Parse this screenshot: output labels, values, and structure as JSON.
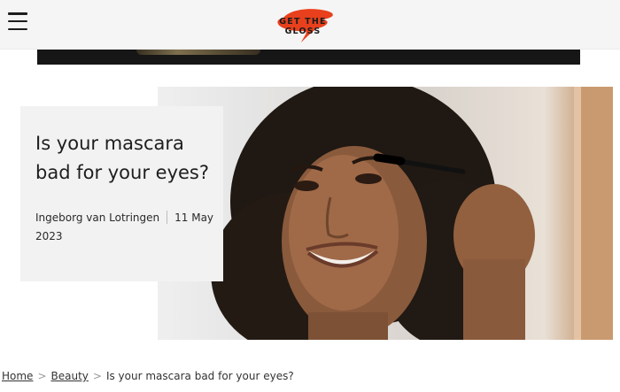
{
  "header": {
    "logo_text": "GET THE GLOSS",
    "brand_color": "#e8401c"
  },
  "article": {
    "title": "Is your mascara bad for your eyes?",
    "author": "Ingeborg van Lotringen",
    "date": "11 May 2023"
  },
  "breadcrumb": {
    "items": [
      "Home",
      "Beauty"
    ],
    "current": "Is your mascara bad for your eyes?"
  }
}
